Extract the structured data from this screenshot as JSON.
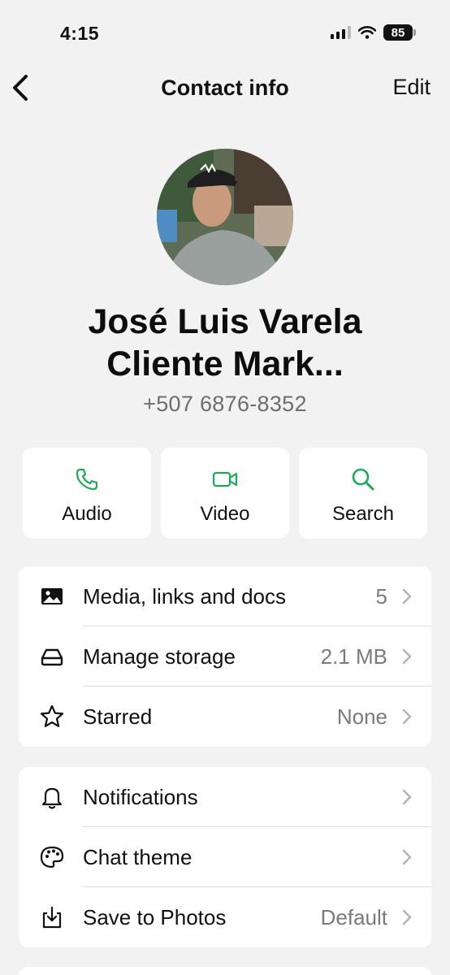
{
  "status_bar": {
    "time": "4:15",
    "battery": "85"
  },
  "nav": {
    "title": "Contact info",
    "edit_label": "Edit"
  },
  "contact": {
    "name_line1": "José Luis Varela",
    "name_line2": "Cliente Mark...",
    "phone": "+507 6876-8352"
  },
  "actions": [
    {
      "label": "Audio",
      "icon": "phone-icon"
    },
    {
      "label": "Video",
      "icon": "video-icon"
    },
    {
      "label": "Search",
      "icon": "search-icon"
    }
  ],
  "group1": [
    {
      "label": "Media, links and docs",
      "value": "5",
      "icon": "image-icon"
    },
    {
      "label": "Manage storage",
      "value": "2.1 MB",
      "icon": "storage-icon"
    },
    {
      "label": "Starred",
      "value": "None",
      "icon": "star-icon"
    }
  ],
  "group2": [
    {
      "label": "Notifications",
      "value": "",
      "icon": "bell-icon"
    },
    {
      "label": "Chat theme",
      "value": "",
      "icon": "palette-icon"
    },
    {
      "label": "Save to Photos",
      "value": "Default",
      "icon": "download-icon"
    }
  ],
  "colors": {
    "accent": "#1fa855",
    "background": "#f2f2f2",
    "card": "#ffffff"
  }
}
